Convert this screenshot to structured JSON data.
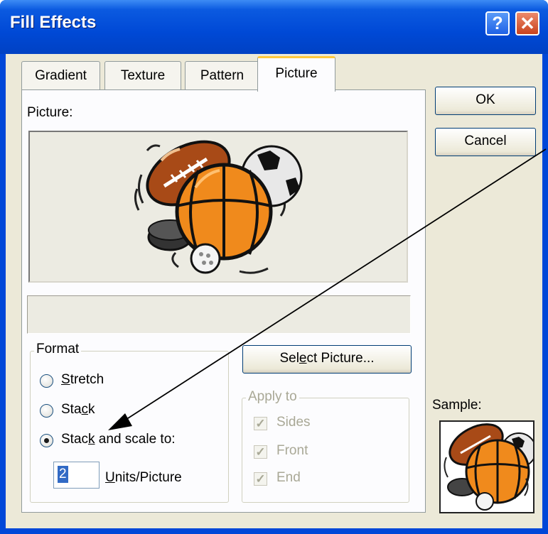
{
  "window": {
    "title": "Fill Effects",
    "help_glyph": "?",
    "close_glyph": "✕"
  },
  "tabs": [
    {
      "label": "Gradient",
      "active": false
    },
    {
      "label": "Texture",
      "active": false
    },
    {
      "label": "Pattern",
      "active": false
    },
    {
      "label": "Picture",
      "active": true
    }
  ],
  "picture_panel": {
    "picture_label": "Picture:",
    "picture_name": "",
    "image_icon": "sports-balls-clipart"
  },
  "format_group": {
    "title": "Format",
    "options": [
      {
        "pre": "",
        "mnemonic": "S",
        "post": "tretch",
        "checked": false
      },
      {
        "pre": "Sta",
        "mnemonic": "c",
        "post": "k",
        "checked": false
      },
      {
        "pre": "Stac",
        "mnemonic": "k",
        "post": " and scale to:",
        "checked": true
      }
    ],
    "units_value": "2",
    "units_label_mnemonic": "U",
    "units_label_rest": "nits/Picture"
  },
  "select_picture_button": {
    "pre": "Sel",
    "mnemonic": "e",
    "post": "ct Picture..."
  },
  "apply_to_group": {
    "title": "Apply to",
    "items": [
      {
        "label": "Sides",
        "checked": true,
        "enabled": false
      },
      {
        "label": "Front",
        "checked": true,
        "enabled": false
      },
      {
        "label": "End",
        "checked": true,
        "enabled": false
      }
    ]
  },
  "buttons": {
    "ok": "OK",
    "cancel": "Cancel"
  },
  "sample": {
    "label": "Sample:"
  },
  "colors": {
    "title_bar": "#0047d8",
    "dialog_face": "#ece9d8",
    "active_tab_accent": "#ffc83c",
    "selection": "#316ac5"
  }
}
